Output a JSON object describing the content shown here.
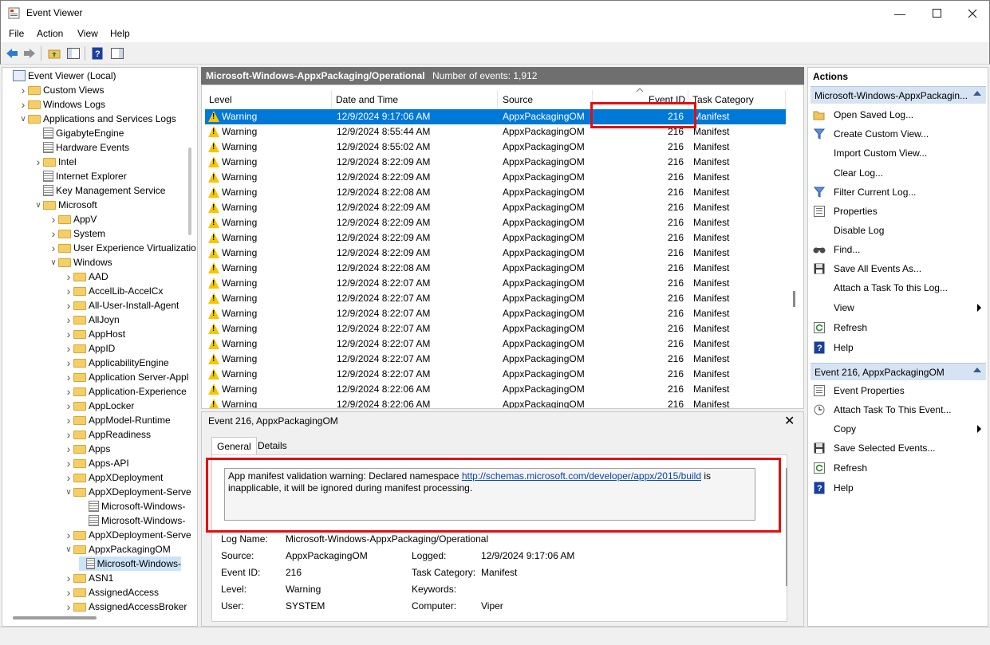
{
  "window": {
    "title": "Event Viewer"
  },
  "menu": [
    "File",
    "Action",
    "View",
    "Help"
  ],
  "tree": [
    {
      "label": "Event Viewer (Local)",
      "depth": 0,
      "chev": "",
      "icon": "computer"
    },
    {
      "label": "Custom Views",
      "depth": 1,
      "chev": ">",
      "icon": "folder"
    },
    {
      "label": "Windows Logs",
      "depth": 1,
      "chev": ">",
      "icon": "folder"
    },
    {
      "label": "Applications and Services Logs",
      "depth": 1,
      "chev": "v",
      "icon": "folder"
    },
    {
      "label": "GigabyteEngine",
      "depth": 2,
      "chev": "",
      "icon": "log"
    },
    {
      "label": "Hardware Events",
      "depth": 2,
      "chev": "",
      "icon": "log"
    },
    {
      "label": "Intel",
      "depth": 2,
      "chev": ">",
      "icon": "folder"
    },
    {
      "label": "Internet Explorer",
      "depth": 2,
      "chev": "",
      "icon": "log"
    },
    {
      "label": "Key Management Service",
      "depth": 2,
      "chev": "",
      "icon": "log"
    },
    {
      "label": "Microsoft",
      "depth": 2,
      "chev": "v",
      "icon": "folder"
    },
    {
      "label": "AppV",
      "depth": 3,
      "chev": ">",
      "icon": "folder"
    },
    {
      "label": "System",
      "depth": 3,
      "chev": ">",
      "icon": "folder"
    },
    {
      "label": "User Experience Virtualizatio",
      "depth": 3,
      "chev": ">",
      "icon": "folder"
    },
    {
      "label": "Windows",
      "depth": 3,
      "chev": "v",
      "icon": "folder"
    },
    {
      "label": "AAD",
      "depth": 4,
      "chev": ">",
      "icon": "folder"
    },
    {
      "label": "AccelLib-AccelCx",
      "depth": 4,
      "chev": ">",
      "icon": "folder"
    },
    {
      "label": "All-User-Install-Agent",
      "depth": 4,
      "chev": ">",
      "icon": "folder"
    },
    {
      "label": "AllJoyn",
      "depth": 4,
      "chev": ">",
      "icon": "folder"
    },
    {
      "label": "AppHost",
      "depth": 4,
      "chev": ">",
      "icon": "folder"
    },
    {
      "label": "AppID",
      "depth": 4,
      "chev": ">",
      "icon": "folder"
    },
    {
      "label": "ApplicabilityEngine",
      "depth": 4,
      "chev": ">",
      "icon": "folder"
    },
    {
      "label": "Application Server-Appl",
      "depth": 4,
      "chev": ">",
      "icon": "folder"
    },
    {
      "label": "Application-Experience",
      "depth": 4,
      "chev": ">",
      "icon": "folder"
    },
    {
      "label": "AppLocker",
      "depth": 4,
      "chev": ">",
      "icon": "folder"
    },
    {
      "label": "AppModel-Runtime",
      "depth": 4,
      "chev": ">",
      "icon": "folder"
    },
    {
      "label": "AppReadiness",
      "depth": 4,
      "chev": ">",
      "icon": "folder"
    },
    {
      "label": "Apps",
      "depth": 4,
      "chev": ">",
      "icon": "folder"
    },
    {
      "label": "Apps-API",
      "depth": 4,
      "chev": ">",
      "icon": "folder"
    },
    {
      "label": "AppXDeployment",
      "depth": 4,
      "chev": ">",
      "icon": "folder"
    },
    {
      "label": "AppXDeployment-Serve",
      "depth": 4,
      "chev": "v",
      "icon": "folder"
    },
    {
      "label": "Microsoft-Windows-",
      "depth": 5,
      "chev": "",
      "icon": "log"
    },
    {
      "label": "Microsoft-Windows-",
      "depth": 5,
      "chev": "",
      "icon": "log"
    },
    {
      "label": "AppXDeployment-Serve",
      "depth": 4,
      "chev": ">",
      "icon": "folder"
    },
    {
      "label": "AppxPackagingOM",
      "depth": 4,
      "chev": "v",
      "icon": "folder"
    },
    {
      "label": "Microsoft-Windows-",
      "depth": 5,
      "chev": "",
      "icon": "log",
      "selected": true
    },
    {
      "label": "ASN1",
      "depth": 4,
      "chev": ">",
      "icon": "folder"
    },
    {
      "label": "AssignedAccess",
      "depth": 4,
      "chev": ">",
      "icon": "folder"
    },
    {
      "label": "AssignedAccessBroker",
      "depth": 4,
      "chev": ">",
      "icon": "folder"
    }
  ],
  "log": {
    "name": "Microsoft-Windows-AppxPackaging/Operational",
    "count": "Number of events: 1,912",
    "columns": [
      "Level",
      "Date and Time",
      "Source",
      "Event ID",
      "Task Category"
    ],
    "rows": [
      {
        "level": "Warning",
        "date": "12/9/2024 9:17:06 AM",
        "source": "AppxPackagingOM",
        "id": "216",
        "task": "Manifest"
      },
      {
        "level": "Warning",
        "date": "12/9/2024 8:55:44 AM",
        "source": "AppxPackagingOM",
        "id": "216",
        "task": "Manifest"
      },
      {
        "level": "Warning",
        "date": "12/9/2024 8:55:02 AM",
        "source": "AppxPackagingOM",
        "id": "216",
        "task": "Manifest"
      },
      {
        "level": "Warning",
        "date": "12/9/2024 8:22:09 AM",
        "source": "AppxPackagingOM",
        "id": "216",
        "task": "Manifest"
      },
      {
        "level": "Warning",
        "date": "12/9/2024 8:22:09 AM",
        "source": "AppxPackagingOM",
        "id": "216",
        "task": "Manifest"
      },
      {
        "level": "Warning",
        "date": "12/9/2024 8:22:08 AM",
        "source": "AppxPackagingOM",
        "id": "216",
        "task": "Manifest"
      },
      {
        "level": "Warning",
        "date": "12/9/2024 8:22:09 AM",
        "source": "AppxPackagingOM",
        "id": "216",
        "task": "Manifest"
      },
      {
        "level": "Warning",
        "date": "12/9/2024 8:22:09 AM",
        "source": "AppxPackagingOM",
        "id": "216",
        "task": "Manifest"
      },
      {
        "level": "Warning",
        "date": "12/9/2024 8:22:09 AM",
        "source": "AppxPackagingOM",
        "id": "216",
        "task": "Manifest"
      },
      {
        "level": "Warning",
        "date": "12/9/2024 8:22:09 AM",
        "source": "AppxPackagingOM",
        "id": "216",
        "task": "Manifest"
      },
      {
        "level": "Warning",
        "date": "12/9/2024 8:22:08 AM",
        "source": "AppxPackagingOM",
        "id": "216",
        "task": "Manifest"
      },
      {
        "level": "Warning",
        "date": "12/9/2024 8:22:07 AM",
        "source": "AppxPackagingOM",
        "id": "216",
        "task": "Manifest"
      },
      {
        "level": "Warning",
        "date": "12/9/2024 8:22:07 AM",
        "source": "AppxPackagingOM",
        "id": "216",
        "task": "Manifest"
      },
      {
        "level": "Warning",
        "date": "12/9/2024 8:22:07 AM",
        "source": "AppxPackagingOM",
        "id": "216",
        "task": "Manifest"
      },
      {
        "level": "Warning",
        "date": "12/9/2024 8:22:07 AM",
        "source": "AppxPackagingOM",
        "id": "216",
        "task": "Manifest"
      },
      {
        "level": "Warning",
        "date": "12/9/2024 8:22:07 AM",
        "source": "AppxPackagingOM",
        "id": "216",
        "task": "Manifest"
      },
      {
        "level": "Warning",
        "date": "12/9/2024 8:22:07 AM",
        "source": "AppxPackagingOM",
        "id": "216",
        "task": "Manifest"
      },
      {
        "level": "Warning",
        "date": "12/9/2024 8:22:07 AM",
        "source": "AppxPackagingOM",
        "id": "216",
        "task": "Manifest"
      },
      {
        "level": "Warning",
        "date": "12/9/2024 8:22:06 AM",
        "source": "AppxPackagingOM",
        "id": "216",
        "task": "Manifest"
      },
      {
        "level": "Warning",
        "date": "12/9/2024 8:22:06 AM",
        "source": "AppxPackagingOM",
        "id": "216",
        "task": "Manifest"
      }
    ]
  },
  "detail": {
    "title": "Event 216, AppxPackagingOM",
    "tabs": [
      "General",
      "Details"
    ],
    "msg_before": "App manifest validation warning: Declared namespace ",
    "msg_link": "http://schemas.microsoft.com/developer/appx/2015/build",
    "msg_after": " is inapplicable, it will be ignored during manifest processing.",
    "log_name_label": "Log Name:",
    "log_name": "Microsoft-Windows-AppxPackaging/Operational",
    "source_label": "Source:",
    "source": "AppxPackagingOM",
    "logged_label": "Logged:",
    "logged": "12/9/2024 9:17:06 AM",
    "event_id_label": "Event ID:",
    "event_id": "216",
    "task_label": "Task Category:",
    "task": "Manifest",
    "level_label": "Level:",
    "level": "Warning",
    "keywords_label": "Keywords:",
    "keywords": "",
    "user_label": "User:",
    "user": "SYSTEM",
    "computer_label": "Computer:",
    "computer": "Viper"
  },
  "actions": {
    "title": "Actions",
    "section1": "Microsoft-Windows-AppxPackagin...",
    "items1": [
      {
        "label": "Open Saved Log...",
        "icon": "open-icon"
      },
      {
        "label": "Create Custom View...",
        "icon": "filter-icon"
      },
      {
        "label": "Import Custom View...",
        "icon": ""
      },
      {
        "label": "Clear Log...",
        "icon": ""
      },
      {
        "label": "Filter Current Log...",
        "icon": "filter-icon"
      },
      {
        "label": "Properties",
        "icon": "properties-icon"
      },
      {
        "label": "Disable Log",
        "icon": ""
      },
      {
        "label": "Find...",
        "icon": "find-icon"
      },
      {
        "label": "Save All Events As...",
        "icon": "save-icon"
      },
      {
        "label": "Attach a Task To this Log...",
        "icon": ""
      },
      {
        "label": "View",
        "icon": "",
        "submenu": true
      },
      {
        "label": "Refresh",
        "icon": "refresh-icon"
      },
      {
        "label": "Help",
        "icon": "help-icon"
      }
    ],
    "section2": "Event 216, AppxPackagingOM",
    "items2": [
      {
        "label": "Event Properties",
        "icon": "properties-icon"
      },
      {
        "label": "Attach Task To This Event...",
        "icon": "task-icon"
      },
      {
        "label": "Copy",
        "icon": "",
        "submenu": true
      },
      {
        "label": "Save Selected Events...",
        "icon": "save-icon"
      },
      {
        "label": "Refresh",
        "icon": "refresh-icon"
      },
      {
        "label": "Help",
        "icon": "help-icon"
      }
    ]
  }
}
